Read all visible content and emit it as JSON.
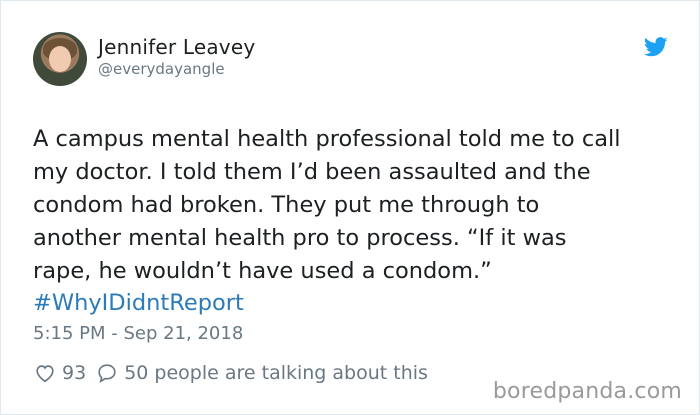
{
  "author": {
    "name": "Jennifer Leavey",
    "handle": "@everydayangle"
  },
  "tweet": {
    "text": "A campus mental health professional told me to call\nmy doctor. I told them I’d been assaulted and the\ncondom had broken. They put me through to\nanother mental health pro to process. “If it was\nrape, he wouldn’t have used a condom.”",
    "hashtag": "#WhyIDidntReport",
    "timestamp": "5:15 PM - Sep 21, 2018"
  },
  "actions": {
    "likes": "93",
    "talking": "50 people are talking about this"
  },
  "watermark": "boredpanda.com",
  "icons": {
    "brand": "twitter-bird-icon",
    "like": "heart-icon",
    "reply": "speech-bubble-icon"
  },
  "colors": {
    "twitter_blue": "#1da1f2",
    "hashtag": "#2b7bb9",
    "muted": "#697882"
  }
}
